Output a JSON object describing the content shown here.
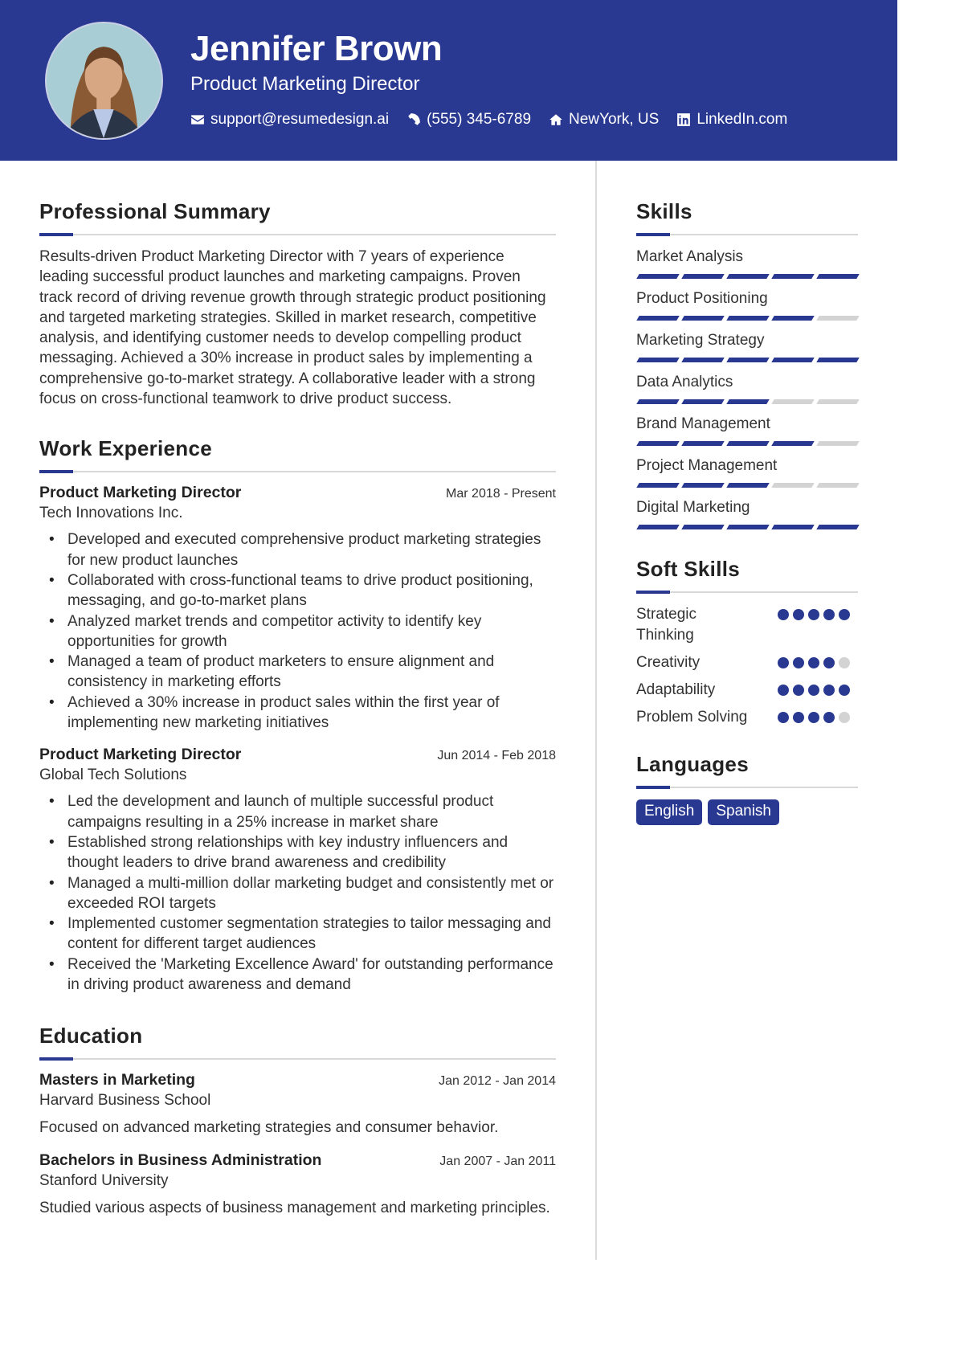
{
  "header": {
    "name": "Jennifer Brown",
    "title": "Product Marketing Director",
    "photo_alt": "profile-photo",
    "contacts": [
      {
        "icon": "envelope-icon",
        "text": "support@resumedesign.ai"
      },
      {
        "icon": "phone-icon",
        "text": "(555) 345-6789"
      },
      {
        "icon": "home-icon",
        "text": "NewYork, US"
      },
      {
        "icon": "linkedin-icon",
        "text": "LinkedIn.com"
      }
    ]
  },
  "summary": {
    "heading": "Professional Summary",
    "text": "Results-driven Product Marketing Director with 7 years of experience leading successful product launches and marketing campaigns. Proven track record of driving revenue growth through strategic product positioning and targeted marketing strategies. Skilled in market research, competitive analysis, and identifying customer needs to develop compelling product messaging. Achieved a 30% increase in product sales by implementing a comprehensive go-to-market strategy. A collaborative leader with a strong focus on cross-functional teamwork to drive product success."
  },
  "experience": {
    "heading": "Work Experience",
    "jobs": [
      {
        "title": "Product Marketing Director",
        "dates": "Mar 2018 - Present",
        "company": "Tech Innovations Inc.",
        "bullets": [
          "Developed and executed comprehensive product marketing strategies for new product launches",
          "Collaborated with cross-functional teams to drive product positioning, messaging, and go-to-market plans",
          "Analyzed market trends and competitor activity to identify key opportunities for growth",
          "Managed a team of product marketers to ensure alignment and consistency in marketing efforts",
          "Achieved a 30% increase in product sales within the first year of implementing new marketing initiatives"
        ]
      },
      {
        "title": "Product Marketing Director",
        "dates": "Jun 2014 - Feb 2018",
        "company": "Global Tech Solutions",
        "bullets": [
          "Led the development and launch of multiple successful product campaigns resulting in a 25% increase in market share",
          "Established strong relationships with key industry influencers and thought leaders to drive brand awareness and credibility",
          "Managed a multi-million dollar marketing budget and consistently met or exceeded ROI targets",
          "Implemented customer segmentation strategies to tailor messaging and content for different target audiences",
          "Received the 'Marketing Excellence Award' for outstanding performance in driving product awareness and demand"
        ]
      }
    ]
  },
  "education": {
    "heading": "Education",
    "items": [
      {
        "degree": "Masters in Marketing",
        "dates": "Jan 2012 - Jan 2014",
        "school": "Harvard Business School",
        "description": "Focused on advanced marketing strategies and consumer behavior."
      },
      {
        "degree": "Bachelors in Business Administration",
        "dates": "Jan 2007 - Jan 2011",
        "school": "Stanford University",
        "description": "Studied various aspects of business management and marketing principles."
      }
    ]
  },
  "skills": {
    "heading": "Skills",
    "max": 5,
    "items": [
      {
        "name": "Market Analysis",
        "level": 5
      },
      {
        "name": "Product Positioning",
        "level": 4
      },
      {
        "name": "Marketing Strategy",
        "level": 5
      },
      {
        "name": "Data Analytics",
        "level": 3
      },
      {
        "name": "Brand Management",
        "level": 4
      },
      {
        "name": "Project Management",
        "level": 3
      },
      {
        "name": "Digital Marketing",
        "level": 5
      }
    ]
  },
  "soft_skills": {
    "heading": "Soft Skills",
    "max": 5,
    "items": [
      {
        "name": "Strategic Thinking",
        "level": 5
      },
      {
        "name": "Creativity",
        "level": 4
      },
      {
        "name": "Adaptability",
        "level": 5
      },
      {
        "name": "Problem Solving",
        "level": 4
      }
    ]
  },
  "languages": {
    "heading": "Languages",
    "items": [
      "English",
      "Spanish"
    ]
  },
  "colors": {
    "accent": "#293891",
    "inactive": "#d3d3d3"
  }
}
